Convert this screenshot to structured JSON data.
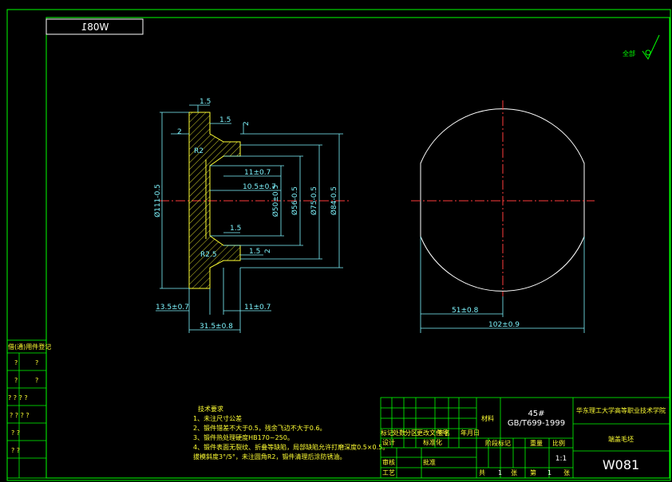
{
  "drawing_number_box": "W081",
  "roughness_note": "全部",
  "section_dims": {
    "d111": "Ø111-0.5",
    "d84": "Ø84-0.5",
    "d75": "Ø75-0.5",
    "d56": "Ø56-0.5",
    "d50": "Ø50±0.5",
    "w1_5_top": "1.5",
    "w1_5_mid": "1.5",
    "w2_top": "2",
    "w2_left": "2",
    "w2_right": "2",
    "r2": "R2",
    "r2_5": "R2.5",
    "d11_top": "11±0.7",
    "d10_5": "10.5±0.7",
    "d1_5_inner": "1.5",
    "d1_5_bottom": "1.5",
    "d13_5": "13.5±0.7",
    "d11_bottom": "11±0.7",
    "d31_5": "31.5±0.8"
  },
  "view_dims": {
    "d51": "51±0.8",
    "d102": "102±0.9"
  },
  "tech_notes": {
    "title": "技术要求",
    "lines": [
      "1、未注尺寸公差",
      "2、锻件错差不大于0.5，残余飞边不大于0.6。",
      "3、锻件热处理硬度HB170~250。",
      "4、锻件表面无裂纹、折叠等缺陷，局部缺陷允许打磨深度0.5×0.5。",
      "拔模斜度3°/5°，未注圆角R2，锻件清理后涂防锈油。"
    ]
  },
  "title_block": {
    "material": "45#",
    "standard": "GB/T699-1999",
    "school": "华东理工大学高等职业技术学院",
    "part_name": "端盖毛坯",
    "drawing_no": "W081",
    "scale": "1:1",
    "sheet_total": "1",
    "sheet_no": "1",
    "row_labels": [
      "标记",
      "处数",
      "分区",
      "更改文件号",
      "签名",
      "年月日"
    ],
    "design_label": "设计",
    "std_label": "标准化",
    "check_label": "审核",
    "craft_label": "工艺",
    "approve_label": "批准",
    "stage_label": "阶段标记",
    "weight_label": "重量",
    "scale_label": "比例",
    "total_label": "共",
    "sheet_label": "第",
    "zhang": "张",
    "material_label": "材料"
  },
  "side_table": {
    "header": "借(通)用件登记",
    "rows": [
      "?",
      "?",
      "? ?",
      "? ? ? ?",
      "? ? ? ?",
      "? ?",
      "? ?"
    ]
  }
}
